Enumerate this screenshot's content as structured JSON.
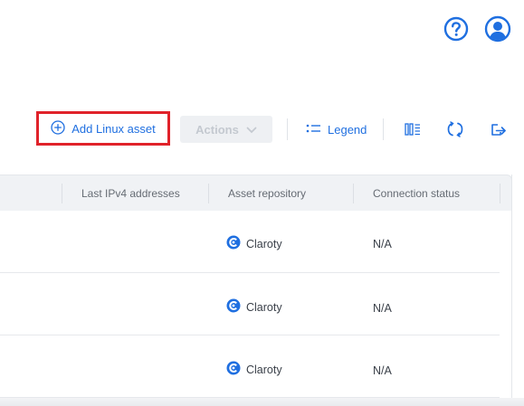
{
  "header": {
    "help_icon": "question-circle-icon",
    "user_icon": "user-circle-icon",
    "accent_color": "#1f6fe0"
  },
  "toolbar": {
    "add_label": "Add Linux asset",
    "actions_label": "Actions",
    "legend_label": "Legend",
    "highlight_color": "#e0222a"
  },
  "table": {
    "columns": [
      "Last IPv4 addresses",
      "Asset repository",
      "Connection status"
    ],
    "rows": [
      {
        "repository": "Claroty",
        "status": "N/A"
      },
      {
        "repository": "Claroty",
        "status": "N/A"
      },
      {
        "repository": "Claroty",
        "status": "N/A"
      }
    ]
  }
}
